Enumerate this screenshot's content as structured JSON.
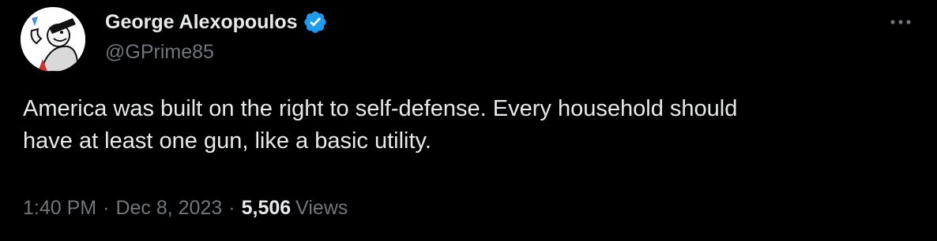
{
  "author": {
    "display_name": "George Alexopoulos",
    "handle": "@GPrime85",
    "verified": true,
    "verified_badge_color": "#1d9bf0"
  },
  "tweet": {
    "text_line1": "America was built on the right to self-defense. Every household should",
    "text_line2": "have at least one gun, like a basic utility."
  },
  "meta": {
    "time": "1:40 PM",
    "separator": "·",
    "date": "Dec 8, 2023",
    "views_count": "5,506",
    "views_label": "Views"
  },
  "icons": {
    "more": "more-horizontal-icon",
    "verified": "verified-badge-icon"
  },
  "colors": {
    "background": "#000000",
    "primary_text": "#e7e9ea",
    "secondary_text": "#71767b",
    "accent": "#1d9bf0"
  }
}
